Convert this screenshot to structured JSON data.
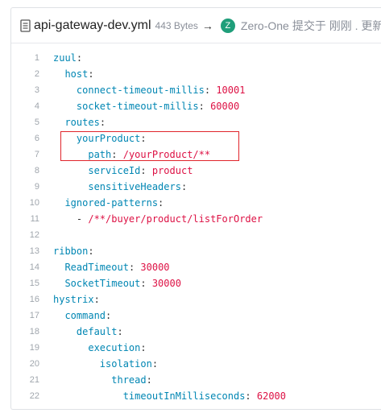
{
  "file": {
    "name": "api-gateway-dev.yml",
    "size": "443 Bytes",
    "arrow": "→",
    "avatar_letter": "Z",
    "avatar_color": "#1f9e7a",
    "commit_author": "Zero-One",
    "commit_message": "提交于 刚刚 . 更新"
  },
  "code_lines": [
    {
      "n": "1",
      "indent": "",
      "key": "zuul",
      "sep": ":",
      "val": ""
    },
    {
      "n": "2",
      "indent": "  ",
      "key": "host",
      "sep": ":",
      "val": ""
    },
    {
      "n": "3",
      "indent": "    ",
      "key": "connect-timeout-millis",
      "sep": ": ",
      "val": "10001"
    },
    {
      "n": "4",
      "indent": "    ",
      "key": "socket-timeout-millis",
      "sep": ": ",
      "val": "60000"
    },
    {
      "n": "5",
      "indent": "  ",
      "key": "routes",
      "sep": ":",
      "val": ""
    },
    {
      "n": "6",
      "indent": "    ",
      "key": "yourProduct",
      "sep": ":",
      "val": ""
    },
    {
      "n": "7",
      "indent": "      ",
      "key": "path",
      "sep": ": ",
      "val": "/yourProduct/**"
    },
    {
      "n": "8",
      "indent": "      ",
      "key": "serviceId",
      "sep": ": ",
      "val": "product"
    },
    {
      "n": "9",
      "indent": "      ",
      "key": "sensitiveHeaders",
      "sep": ":",
      "val": ""
    },
    {
      "n": "10",
      "indent": "  ",
      "key": "ignored-patterns",
      "sep": ":",
      "val": ""
    },
    {
      "n": "11",
      "indent": "    ",
      "key": "",
      "sep": "- ",
      "val": "/**/buyer/product/listForOrder"
    },
    {
      "n": "12",
      "indent": "",
      "key": "",
      "sep": "",
      "val": ""
    },
    {
      "n": "13",
      "indent": "",
      "key": "ribbon",
      "sep": ":",
      "val": ""
    },
    {
      "n": "14",
      "indent": "  ",
      "key": "ReadTimeout",
      "sep": ": ",
      "val": "30000"
    },
    {
      "n": "15",
      "indent": "  ",
      "key": "SocketTimeout",
      "sep": ": ",
      "val": "30000"
    },
    {
      "n": "16",
      "indent": "",
      "key": "hystrix",
      "sep": ":",
      "val": ""
    },
    {
      "n": "17",
      "indent": "  ",
      "key": "command",
      "sep": ":",
      "val": ""
    },
    {
      "n": "18",
      "indent": "    ",
      "key": "default",
      "sep": ":",
      "val": ""
    },
    {
      "n": "19",
      "indent": "      ",
      "key": "execution",
      "sep": ":",
      "val": ""
    },
    {
      "n": "20",
      "indent": "        ",
      "key": "isolation",
      "sep": ":",
      "val": ""
    },
    {
      "n": "21",
      "indent": "          ",
      "key": "thread",
      "sep": ":",
      "val": ""
    },
    {
      "n": "22",
      "indent": "            ",
      "key": "timeoutInMilliseconds",
      "sep": ": ",
      "val": "62000"
    }
  ],
  "colors": {
    "key": "#0086b3",
    "value": "#dd1144",
    "highlight_border": "#e0252b"
  }
}
